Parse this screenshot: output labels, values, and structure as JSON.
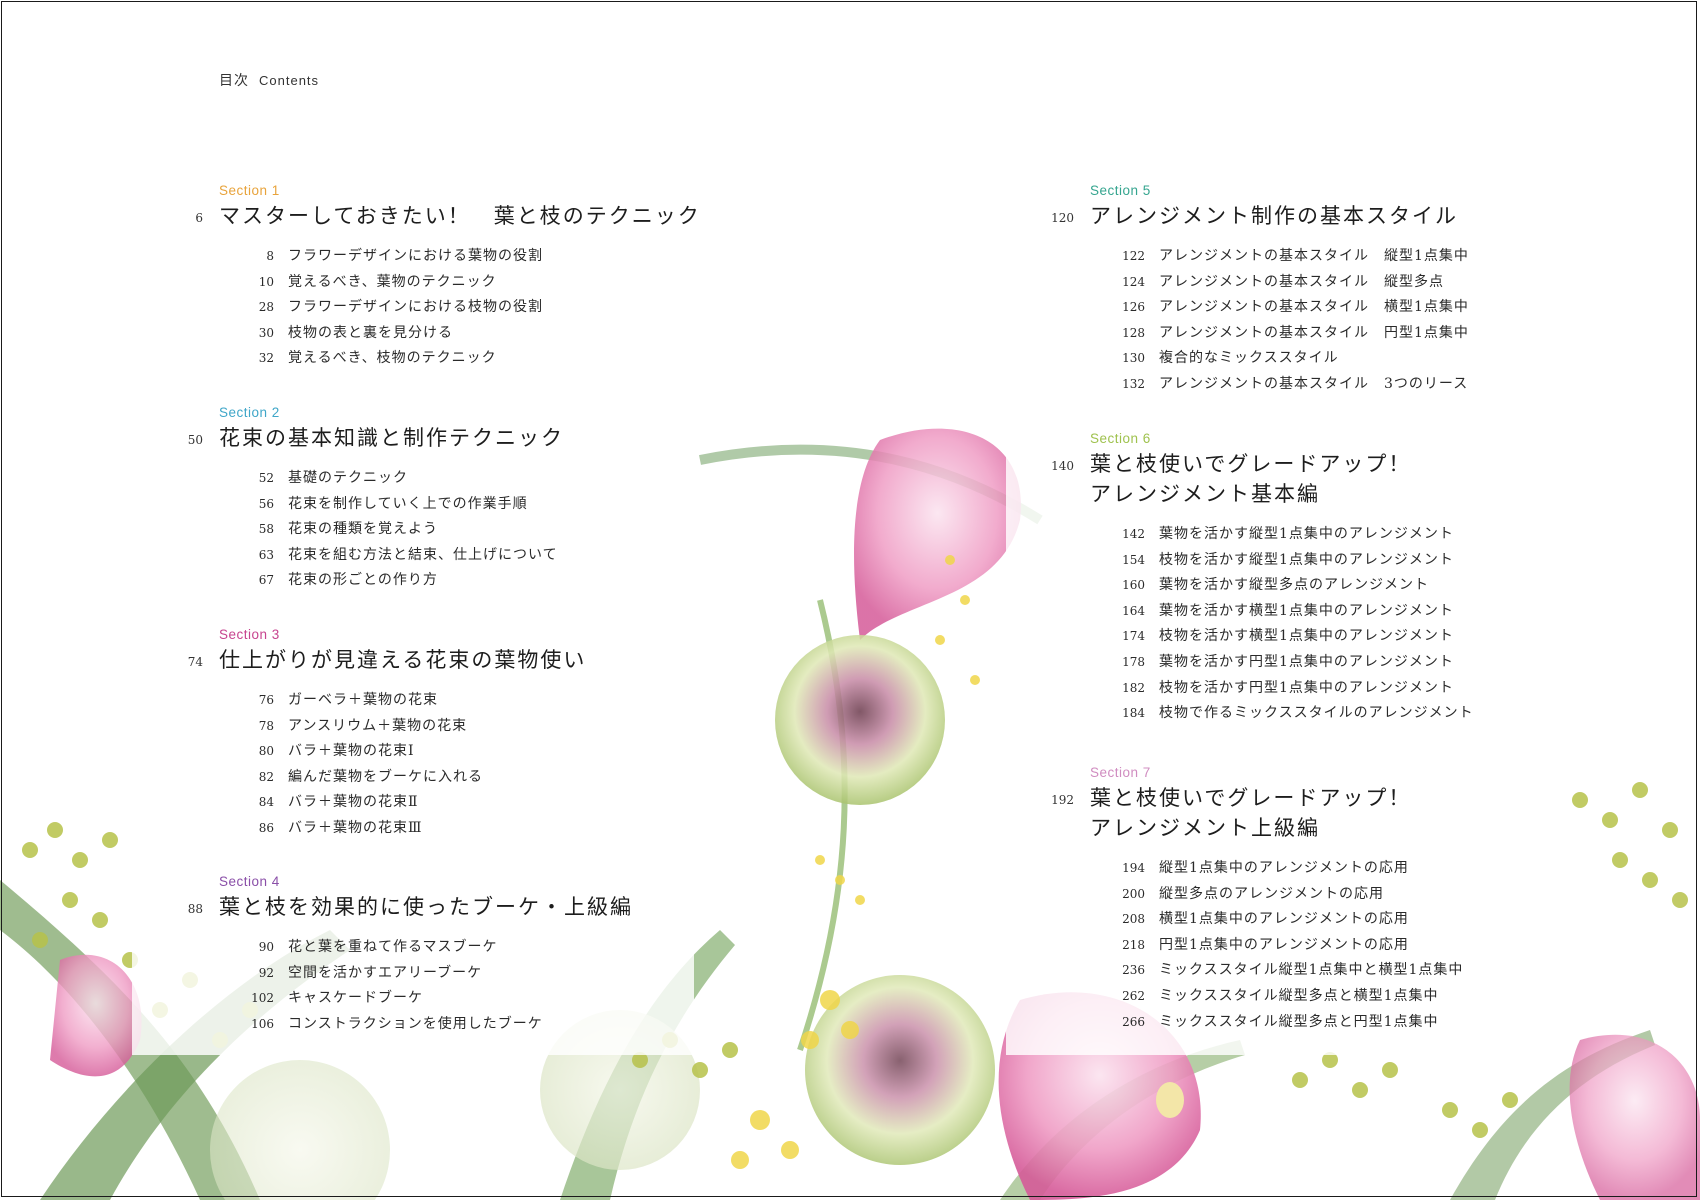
{
  "header": {
    "ja": "目次",
    "en": "Contents"
  },
  "colors": {
    "section1": "#e8a33b",
    "section2": "#3fa6c8",
    "section3": "#c7448f",
    "section4": "#8a4fa8",
    "section5": "#35a58f",
    "section6": "#9fc24e",
    "section7": "#d08cc0"
  },
  "sections": [
    {
      "label": "Section 1",
      "page": "6",
      "title": "マスターしておきたい！　葉と枝のテクニック",
      "items": [
        {
          "page": "8",
          "title": "フラワーデザインにおける葉物の役割"
        },
        {
          "page": "10",
          "title": "覚えるべき、葉物のテクニック"
        },
        {
          "page": "28",
          "title": "フラワーデザインにおける枝物の役割"
        },
        {
          "page": "30",
          "title": "枝物の表と裏を見分ける"
        },
        {
          "page": "32",
          "title": "覚えるべき、枝物のテクニック"
        }
      ]
    },
    {
      "label": "Section 2",
      "page": "50",
      "title": "花束の基本知識と制作テクニック",
      "items": [
        {
          "page": "52",
          "title": "基礎のテクニック"
        },
        {
          "page": "56",
          "title": "花束を制作していく上での作業手順"
        },
        {
          "page": "58",
          "title": "花束の種類を覚えよう"
        },
        {
          "page": "63",
          "title": "花束を組む方法と結束、仕上げについて"
        },
        {
          "page": "67",
          "title": "花束の形ごとの作り方"
        }
      ]
    },
    {
      "label": "Section 3",
      "page": "74",
      "title": "仕上がりが見違える花束の葉物使い",
      "items": [
        {
          "page": "76",
          "title": "ガーベラ＋葉物の花束"
        },
        {
          "page": "78",
          "title": "アンスリウム＋葉物の花束"
        },
        {
          "page": "80",
          "title": "バラ＋葉物の花束Ⅰ"
        },
        {
          "page": "82",
          "title": "編んだ葉物をブーケに入れる"
        },
        {
          "page": "84",
          "title": "バラ＋葉物の花束Ⅱ"
        },
        {
          "page": "86",
          "title": "バラ＋葉物の花束Ⅲ"
        }
      ]
    },
    {
      "label": "Section 4",
      "page": "88",
      "title": "葉と枝を効果的に使ったブーケ・上級編",
      "items": [
        {
          "page": "90",
          "title": "花と葉を重ねて作るマスブーケ"
        },
        {
          "page": "92",
          "title": "空間を活かすエアリーブーケ"
        },
        {
          "page": "102",
          "title": "キャスケードブーケ"
        },
        {
          "page": "106",
          "title": "コンストラクションを使用したブーケ"
        }
      ]
    },
    {
      "label": "Section 5",
      "page": "120",
      "title": "アレンジメント制作の基本スタイル",
      "items": [
        {
          "page": "122",
          "title": "アレンジメントの基本スタイル　縦型1点集中"
        },
        {
          "page": "124",
          "title": "アレンジメントの基本スタイル　縦型多点"
        },
        {
          "page": "126",
          "title": "アレンジメントの基本スタイル　横型1点集中"
        },
        {
          "page": "128",
          "title": "アレンジメントの基本スタイル　円型1点集中"
        },
        {
          "page": "130",
          "title": "複合的なミックススタイル"
        },
        {
          "page": "132",
          "title": "アレンジメントの基本スタイル　3つのリース"
        }
      ]
    },
    {
      "label": "Section 6",
      "page": "140",
      "title": "葉と枝使いでグレードアップ！",
      "title2": "アレンジメント基本編",
      "items": [
        {
          "page": "142",
          "title": "葉物を活かす縦型1点集中のアレンジメント"
        },
        {
          "page": "154",
          "title": "枝物を活かす縦型1点集中のアレンジメント"
        },
        {
          "page": "160",
          "title": "葉物を活かす縦型多点のアレンジメント"
        },
        {
          "page": "164",
          "title": "葉物を活かす横型1点集中のアレンジメント"
        },
        {
          "page": "174",
          "title": "枝物を活かす横型1点集中のアレンジメント"
        },
        {
          "page": "178",
          "title": "葉物を活かす円型1点集中のアレンジメント"
        },
        {
          "page": "182",
          "title": "枝物を活かす円型1点集中のアレンジメント"
        },
        {
          "page": "184",
          "title": "枝物で作るミックススタイルのアレンジメント"
        }
      ]
    },
    {
      "label": "Section 7",
      "page": "192",
      "title": "葉と枝使いでグレードアップ！",
      "title2": "アレンジメント上級編",
      "items": [
        {
          "page": "194",
          "title": "縦型1点集中のアレンジメントの応用"
        },
        {
          "page": "200",
          "title": "縦型多点のアレンジメントの応用"
        },
        {
          "page": "208",
          "title": "横型1点集中のアレンジメントの応用"
        },
        {
          "page": "218",
          "title": "円型1点集中のアレンジメントの応用"
        },
        {
          "page": "236",
          "title": "ミックススタイル縦型1点集中と横型1点集中"
        },
        {
          "page": "262",
          "title": "ミックススタイル縦型多点と横型1点集中"
        },
        {
          "page": "266",
          "title": "ミックススタイル縦型多点と円型1点集中"
        }
      ]
    }
  ]
}
